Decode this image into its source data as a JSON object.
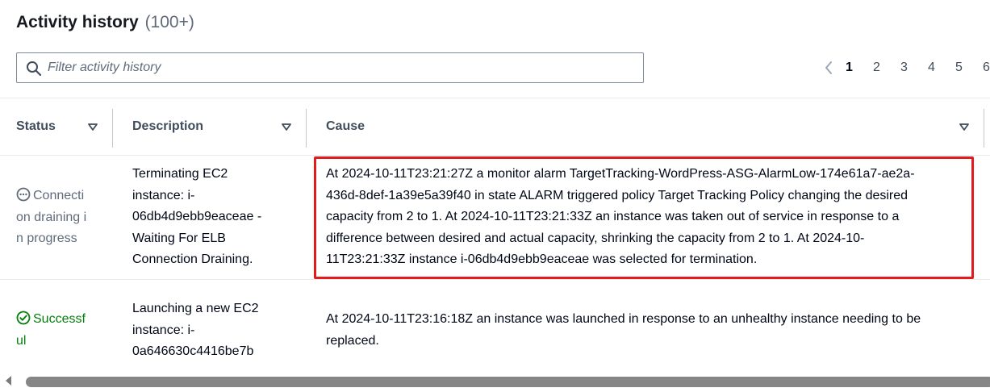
{
  "header": {
    "title": "Activity history",
    "count": "(100+)"
  },
  "filter": {
    "placeholder": "Filter activity history",
    "value": ""
  },
  "pagination": {
    "pages": [
      "1",
      "2",
      "3",
      "4",
      "5",
      "6"
    ],
    "current": "1"
  },
  "table": {
    "columns": {
      "status": "Status",
      "description": "Description",
      "cause": "Cause"
    },
    "rows": [
      {
        "status": "Connection draining in progress",
        "status_lines": [
          "Connecti",
          "on draining i",
          "n progress"
        ],
        "status_icon": "ellipsis-circle-icon",
        "description_lines": [
          "Terminating EC2",
          "instance: i-",
          "06db4d9ebb9eaceae -",
          "Waiting For ELB",
          "Connection Draining."
        ],
        "cause_lines": [
          "At 2024-10-11T23:21:27Z a monitor alarm TargetTracking-WordPress-ASG-AlarmLow-174e61a7-ae2a-",
          "436d-8def-1a39e5a39f40 in state ALARM triggered policy Target Tracking Policy changing the desired",
          "capacity from 2 to 1. At 2024-10-11T23:21:33Z an instance was taken out of service in response to a",
          "difference between desired and actual capacity, shrinking the capacity from 2 to 1. At 2024-10-",
          "11T23:21:33Z instance i-06db4d9ebb9eaceae was selected for termination."
        ]
      },
      {
        "status": "Successful",
        "status_lines": [
          "Successf",
          "ul"
        ],
        "status_icon": "check-circle-icon",
        "description_lines": [
          "Launching a new EC2",
          "instance: i-",
          "0a646630c4416be7b"
        ],
        "cause_lines": [
          "At 2024-10-11T23:16:18Z an instance was launched in response to an unhealthy instance needing to be",
          "replaced."
        ]
      }
    ]
  },
  "colors": {
    "accent_highlight": "#e41a1c",
    "success": "#037f0c",
    "in_progress": "#5f6b7a"
  }
}
